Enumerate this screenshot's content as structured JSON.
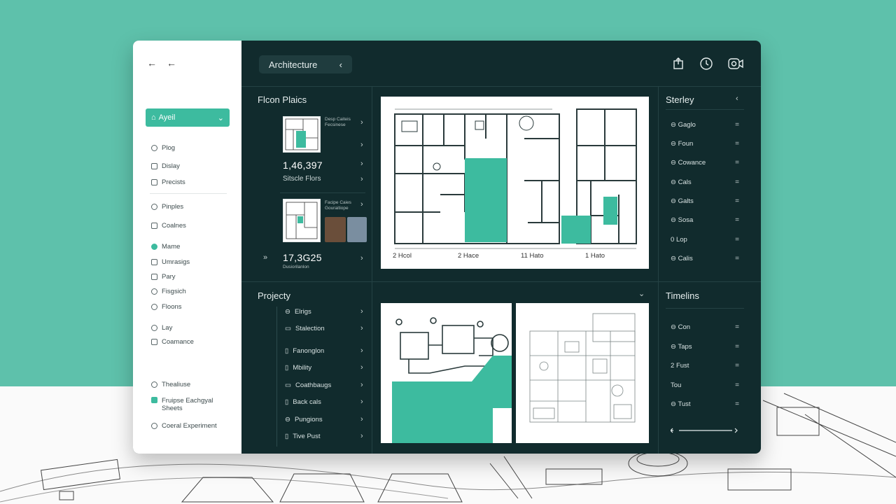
{
  "app": {
    "title": "Architecture",
    "project_selector": "Ayeil"
  },
  "sidebar": {
    "groups": [
      [
        {
          "label": "Plog",
          "icon": "user-icon"
        },
        {
          "label": "Dislay",
          "icon": "monitor-icon"
        },
        {
          "label": "Precists",
          "icon": "layers-icon"
        }
      ],
      [
        {
          "label": "Pinples",
          "icon": "pin-icon"
        },
        {
          "label": "Coalnes",
          "icon": "pen-icon"
        }
      ],
      [
        {
          "label": "Mame",
          "icon": "dot-icon",
          "active": true
        },
        {
          "label": "Umrasigs",
          "icon": "file-icon"
        },
        {
          "label": "Pary",
          "icon": "folder-icon"
        },
        {
          "label": "Fisgsich",
          "icon": "settings-icon"
        },
        {
          "label": "Floons",
          "icon": "location-icon"
        }
      ],
      [
        {
          "label": "Lay",
          "icon": "search-icon"
        },
        {
          "label": "Coamance",
          "icon": "calendar-icon"
        }
      ],
      [
        {
          "label": "Thealiuse",
          "icon": "search-icon"
        },
        {
          "label": "Fruipse Eachgyal Sheets",
          "icon": "checkbox-icon"
        },
        {
          "label": "Coeral Experiment",
          "icon": "info-icon"
        }
      ]
    ]
  },
  "floor_plans": {
    "title": "Flcon Plaics",
    "card1": {
      "caption": "Desp Caiteis Fecsinese",
      "value": "1,46,397",
      "label": "Sitscle Flors"
    },
    "card2": {
      "caption": "Facipe Caies Gouraitiope",
      "value": "17,3G25",
      "label": "Dusiorilanlon"
    }
  },
  "main_plan": {
    "labels": [
      "2 Hcol",
      "2 Hace",
      "11 Hato",
      "1 Hato"
    ]
  },
  "steries": {
    "title": "Sterley",
    "items": [
      "Gaglo",
      "Foun",
      "Cowance",
      "Cals",
      "Galts",
      "Sosa",
      "Lop",
      "Calis"
    ]
  },
  "projecty": {
    "title": "Projecty",
    "items": [
      "Elrigs",
      "Stalection",
      "Fanonglon",
      "Mbility",
      "Coathbaugs",
      "Back cals",
      "Pungions",
      "Tive Pust"
    ]
  },
  "timeline": {
    "title": "Timelins",
    "items": [
      {
        "prefix": "⊖",
        "label": "Con"
      },
      {
        "prefix": "⊖",
        "label": "Taps"
      },
      {
        "prefix": "2",
        "label": "Fust"
      },
      {
        "prefix": "",
        "label": "Tou"
      },
      {
        "prefix": "⊖",
        "label": "Tust"
      }
    ]
  },
  "colors": {
    "accent": "#3dbb9f",
    "panel": "#112b2d",
    "background": "#5ec1ab"
  }
}
